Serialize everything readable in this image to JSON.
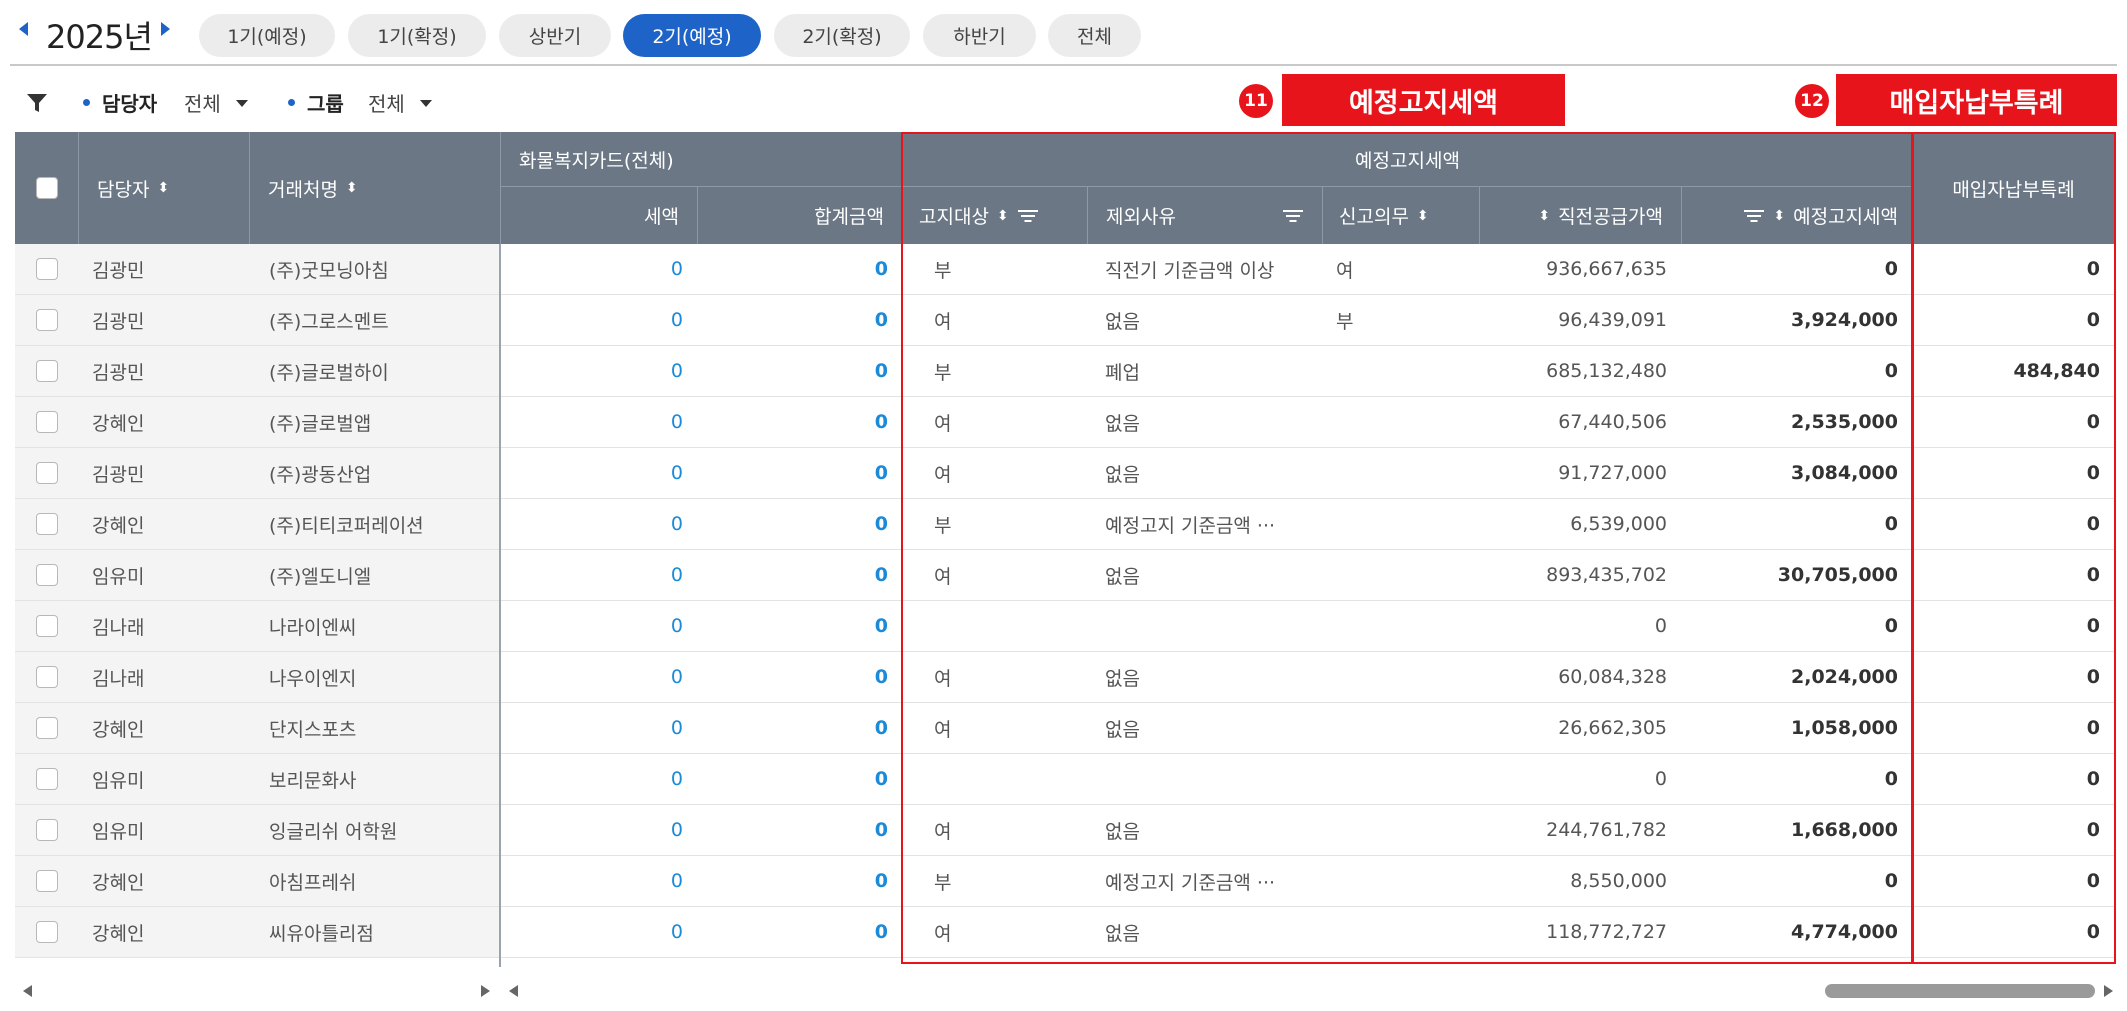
{
  "period_bar": {
    "year": "2025년",
    "tabs": [
      "1기(예정)",
      "1기(확정)",
      "상반기",
      "2기(예정)",
      "2기(확정)",
      "하반기",
      "전체"
    ],
    "active_tab": "2기(예정)"
  },
  "filters": {
    "manager_label": "담당자",
    "manager_value": "전체",
    "group_label": "그룹",
    "group_value": "전체"
  },
  "callouts": [
    {
      "number": "11",
      "label": "예정고지세액"
    },
    {
      "number": "12",
      "label": "매입자납부특례"
    }
  ],
  "grid": {
    "headers": {
      "manager": "담당자",
      "client": "거래처명",
      "card_group": "화물복지카드(전체)",
      "card_tax": "세액",
      "card_total": "합계금액",
      "notice_group": "예정고지세액",
      "notice_target": "고지대상",
      "exclusion_reason": "제외사유",
      "filing_duty": "신고의무",
      "prev_supply": "직전공급가액",
      "notice_tax": "예정고지세액",
      "buyer_special": "매입자납부특례"
    },
    "rows": [
      {
        "manager": "김광민",
        "client": "(주)굿모닝아침",
        "card_tax": "0",
        "card_total": "0",
        "notice_target": "부",
        "reason": "직전기 기준금액 이상",
        "duty": "여",
        "prev_supply": "936,667,635",
        "notice_tax": "0",
        "buyer_special": "0"
      },
      {
        "manager": "김광민",
        "client": "(주)그로스멘트",
        "card_tax": "0",
        "card_total": "0",
        "notice_target": "여",
        "reason": "없음",
        "duty": "부",
        "prev_supply": "96,439,091",
        "notice_tax": "3,924,000",
        "buyer_special": "0"
      },
      {
        "manager": "김광민",
        "client": "(주)글로벌하이",
        "card_tax": "0",
        "card_total": "0",
        "notice_target": "부",
        "reason": "폐업",
        "duty": "",
        "prev_supply": "685,132,480",
        "notice_tax": "0",
        "buyer_special": "484,840"
      },
      {
        "manager": "강혜인",
        "client": "(주)글로벌앱",
        "card_tax": "0",
        "card_total": "0",
        "notice_target": "여",
        "reason": "없음",
        "duty": "",
        "prev_supply": "67,440,506",
        "notice_tax": "2,535,000",
        "buyer_special": "0"
      },
      {
        "manager": "김광민",
        "client": "(주)광동산업",
        "card_tax": "0",
        "card_total": "0",
        "notice_target": "여",
        "reason": "없음",
        "duty": "",
        "prev_supply": "91,727,000",
        "notice_tax": "3,084,000",
        "buyer_special": "0"
      },
      {
        "manager": "강혜인",
        "client": "(주)티티코퍼레이션",
        "card_tax": "0",
        "card_total": "0",
        "notice_target": "부",
        "reason": "예정고지 기준금액 ···",
        "duty": "",
        "prev_supply": "6,539,000",
        "notice_tax": "0",
        "buyer_special": "0"
      },
      {
        "manager": "임유미",
        "client": "(주)엘도니엘",
        "card_tax": "0",
        "card_total": "0",
        "notice_target": "여",
        "reason": "없음",
        "duty": "",
        "prev_supply": "893,435,702",
        "notice_tax": "30,705,000",
        "buyer_special": "0"
      },
      {
        "manager": "김나래",
        "client": "나라이엔씨",
        "card_tax": "0",
        "card_total": "0",
        "notice_target": "",
        "reason": "",
        "duty": "",
        "prev_supply": "0",
        "notice_tax": "0",
        "buyer_special": "0"
      },
      {
        "manager": "김나래",
        "client": "나우이엔지",
        "card_tax": "0",
        "card_total": "0",
        "notice_target": "여",
        "reason": "없음",
        "duty": "",
        "prev_supply": "60,084,328",
        "notice_tax": "2,024,000",
        "buyer_special": "0"
      },
      {
        "manager": "강혜인",
        "client": "단지스포츠",
        "card_tax": "0",
        "card_total": "0",
        "notice_target": "여",
        "reason": "없음",
        "duty": "",
        "prev_supply": "26,662,305",
        "notice_tax": "1,058,000",
        "buyer_special": "0"
      },
      {
        "manager": "임유미",
        "client": "보리문화사",
        "card_tax": "0",
        "card_total": "0",
        "notice_target": "",
        "reason": "",
        "duty": "",
        "prev_supply": "0",
        "notice_tax": "0",
        "buyer_special": "0"
      },
      {
        "manager": "임유미",
        "client": "잉글리쉬 어학원",
        "card_tax": "0",
        "card_total": "0",
        "notice_target": "여",
        "reason": "없음",
        "duty": "",
        "prev_supply": "244,761,782",
        "notice_tax": "1,668,000",
        "buyer_special": "0"
      },
      {
        "manager": "강혜인",
        "client": "아침프레쉬",
        "card_tax": "0",
        "card_total": "0",
        "notice_target": "부",
        "reason": "예정고지 기준금액 ···",
        "duty": "",
        "prev_supply": "8,550,000",
        "notice_tax": "0",
        "buyer_special": "0"
      },
      {
        "manager": "강혜인",
        "client": "씨유아틀리점",
        "card_tax": "0",
        "card_total": "0",
        "notice_target": "여",
        "reason": "없음",
        "duty": "",
        "prev_supply": "118,772,727",
        "notice_tax": "4,774,000",
        "buyer_special": "0"
      }
    ]
  },
  "colors": {
    "accent": "#1d63c8",
    "header_bg": "#6b7785",
    "callout_red": "#e8141b",
    "value_blue": "#1b8ad8"
  }
}
